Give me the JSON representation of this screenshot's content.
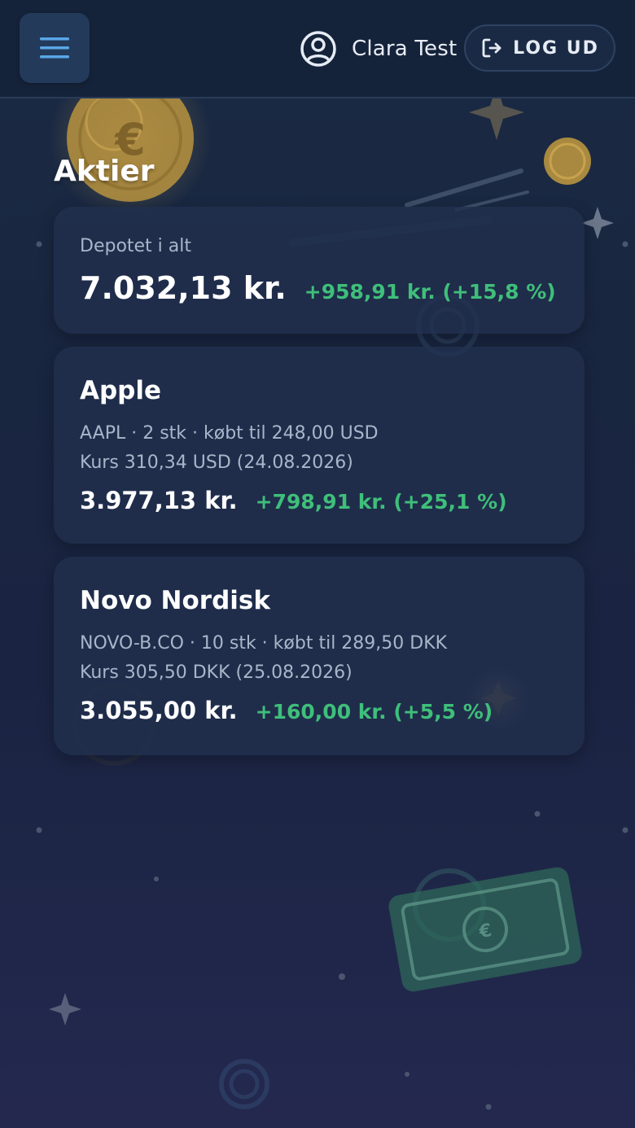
{
  "header": {
    "menu_icon": "hamburger-menu-icon",
    "user_icon": "user-circle-icon",
    "user_name": "Clara Test",
    "logout_icon": "logout-icon",
    "logout_label": "LOG UD"
  },
  "page": {
    "title": "Aktier"
  },
  "summary": {
    "label": "Depotet i alt",
    "total": "7.032,13 kr.",
    "change": "+958,91 kr. (+15,8 %)"
  },
  "stocks": [
    {
      "name": "Apple",
      "details": "AAPL · 2 stk · købt til 248,00 USD",
      "price": "Kurs 310,34 USD (24.08.2026)",
      "value": "3.977,13 kr.",
      "change": "+798,91 kr. (+25,1 %)"
    },
    {
      "name": "Novo Nordisk",
      "details": "NOVO-B.CO · 10 stk · købt til 289,50 DKK",
      "price": "Kurs 305,50 DKK (25.08.2026)",
      "value": "3.055,00 kr.",
      "change": "+160,00 kr. (+5,5 %)"
    }
  ],
  "colors": {
    "background": "#1a2a44",
    "card": "#21304e",
    "positive": "#3fbf7a",
    "muted_text": "#a9b6c9",
    "menu_accent": "#5aa6e8",
    "coin_gold": "#c9a24a",
    "banknote_green": "#2f6b5a"
  }
}
